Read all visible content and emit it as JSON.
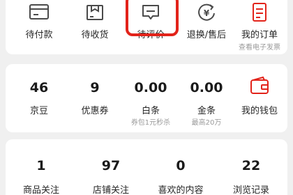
{
  "orders": {
    "items": [
      {
        "label": "待付款",
        "icon": "wallet-card-icon"
      },
      {
        "label": "待收货",
        "icon": "package-box-icon"
      },
      {
        "label": "待评价",
        "icon": "comment-icon"
      },
      {
        "label": "退换/售后",
        "icon": "yen-refund-icon"
      }
    ],
    "my_orders": {
      "label": "我的订单",
      "sub": "查看电子发票",
      "icon": "order-list-icon"
    }
  },
  "wallet": {
    "items": [
      {
        "value": "46",
        "label": "京豆",
        "sub": ""
      },
      {
        "value": "9",
        "label": "优惠券",
        "sub": ""
      },
      {
        "value": "0.00",
        "label": "白条",
        "sub": "券包1元秒杀"
      },
      {
        "value": "0.00",
        "label": "金条",
        "sub": "最高20万"
      }
    ],
    "my_wallet": {
      "label": "我的钱包",
      "icon": "wallet-icon"
    }
  },
  "activity": {
    "items": [
      {
        "value": "1",
        "label": "商品关注"
      },
      {
        "value": "97",
        "label": "店铺关注"
      },
      {
        "value": "0",
        "label": "喜欢的内容"
      },
      {
        "value": "22",
        "label": "浏览记录"
      }
    ]
  },
  "colors": {
    "accent": "#e2231a",
    "icon_gray": "#4a4a4a",
    "background": "#f0f0f0"
  }
}
